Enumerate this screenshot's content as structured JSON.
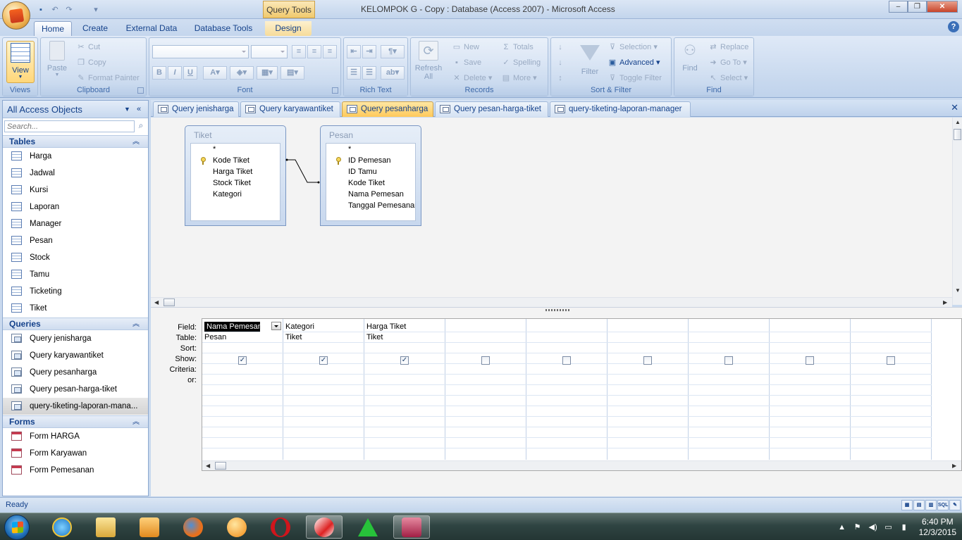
{
  "window": {
    "context_tab": "Query Tools",
    "title": "KELOMPOK G - Copy : Database (Access 2007) - Microsoft Access",
    "minimize": "‒",
    "maximize": "❐",
    "close": "✕"
  },
  "ribbon_tabs": [
    "Home",
    "Create",
    "External Data",
    "Database Tools",
    "Design"
  ],
  "ribbon": {
    "views": {
      "view_label": "View",
      "group": "Views"
    },
    "clipboard": {
      "paste": "Paste",
      "cut": "Cut",
      "copy": "Copy",
      "format_painter": "Format Painter",
      "group": "Clipboard"
    },
    "font": {
      "group": "Font",
      "bold": "B",
      "italic": "I",
      "underline": "U"
    },
    "rich_text": {
      "group": "Rich Text"
    },
    "records": {
      "refresh": "Refresh All",
      "new": "New",
      "save": "Save",
      "delete": "Delete",
      "totals": "Totals",
      "spelling": "Spelling",
      "more": "More",
      "group": "Records"
    },
    "sort_filter": {
      "filter": "Filter",
      "selection": "Selection",
      "advanced": "Advanced",
      "toggle_filter": "Toggle Filter",
      "group": "Sort & Filter"
    },
    "find": {
      "find": "Find",
      "replace": "Replace",
      "go_to": "Go To",
      "select": "Select",
      "group": "Find"
    }
  },
  "nav": {
    "header": "All Access Objects",
    "search_placeholder": "Search...",
    "tables_label": "Tables",
    "tables": [
      "Harga",
      "Jadwal",
      "Kursi",
      "Laporan",
      "Manager",
      "Pesan",
      "Stock",
      "Tamu",
      "Ticketing",
      "Tiket"
    ],
    "queries_label": "Queries",
    "queries": [
      "Query jenisharga",
      "Query karyawantiket",
      "Query pesanharga",
      "Query pesan-harga-tiket",
      "query-tiketing-laporan-mana..."
    ],
    "forms_label": "Forms",
    "forms": [
      "Form HARGA",
      "Form Karyawan",
      "Form Pemesanan"
    ]
  },
  "doc_tabs": [
    "Query jenisharga",
    "Query karyawantiket",
    "Query pesanharga",
    "Query pesan-harga-tiket",
    "query-tiketing-laporan-manager"
  ],
  "active_doc_tab": "Query pesanharga",
  "tables_design": [
    {
      "name": "Tiket",
      "fields": [
        "*",
        "Kode Tiket",
        "Harga Tiket",
        "Stock Tiket",
        "Kategori"
      ],
      "key_field": "Kode Tiket"
    },
    {
      "name": "Pesan",
      "fields": [
        "*",
        "ID Pemesan",
        "ID Tamu",
        "Kode Tiket",
        "Nama Pemesan",
        "Tanggal Pemesanan"
      ],
      "key_field": "ID Pemesan"
    }
  ],
  "qbe": {
    "row_labels": [
      "Field:",
      "Table:",
      "Sort:",
      "Show:",
      "Criteria:",
      "or:"
    ],
    "columns": [
      {
        "field": "Nama Pemesan",
        "table": "Pesan",
        "show": true
      },
      {
        "field": "Kategori",
        "table": "Tiket",
        "show": true
      },
      {
        "field": "Harga Tiket",
        "table": "Tiket",
        "show": true
      },
      {
        "field": "",
        "table": "",
        "show": false
      },
      {
        "field": "",
        "table": "",
        "show": false
      },
      {
        "field": "",
        "table": "",
        "show": false
      },
      {
        "field": "",
        "table": "",
        "show": false
      },
      {
        "field": "",
        "table": "",
        "show": false
      },
      {
        "field": "",
        "table": "",
        "show": false
      }
    ]
  },
  "status": {
    "text": "Ready",
    "sql_label": "SQL"
  },
  "taskbar": {
    "time": "6:40 PM",
    "date": "12/3/2015"
  }
}
